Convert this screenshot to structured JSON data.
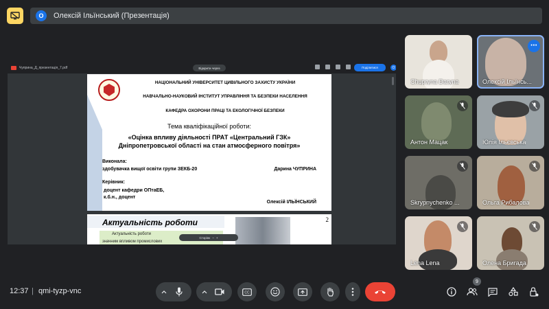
{
  "topbar": {
    "presenter_initial": "О",
    "presenter_title": "Олексій Ільїнський (Презентація)"
  },
  "pdf_viewer": {
    "file_name": "Чуприна_Д_презентація_7.pdf",
    "pill_label": "Відкрити через",
    "share_label": "Поділитися",
    "avatar_initial": "О",
    "zoom_label": "Сторінк"
  },
  "slide": {
    "line1": "НАЦІОНАЛЬНИЙ УНІВЕРСИТЕТ ЦИВІЛЬНОГО ЗАХИСТУ УКРАЇНИ",
    "line2": "НАВЧАЛЬНО-НАУКОВИЙ ІНСТИТУТ УПРАВЛІННЯ ТА БЕЗПЕКИ НАСЕЛЕННЯ",
    "line3": "КАФЕДРА ОХОРОНИ ПРАЦІ ТА ЕКОЛОГІЧНОЇ БЕЗПЕКИ",
    "topic_label": "Тема кваліфікаційної роботи:",
    "topic_line1": "«Оцінка впливу діяльності ПРАТ «Центральний ГЗК»",
    "topic_line2": "Дніпропетровської області на стан атмосферного повітря»",
    "performer_label": "Виконала:",
    "performer_desc": "здобувачка вищої освіти групи ЗЕКБ-20",
    "performer_name": "Дарина ЧУПРИНА",
    "supervisor_label": "Керівник:",
    "supervisor_desc1": "доцент кафедри ОПтаЕБ,",
    "supervisor_desc2": "к.б.н., доцент",
    "supervisor_name": "Олексій ІЛЬЇНСЬКИЙ"
  },
  "slide2": {
    "title": "Актуальність роботи",
    "page_number": "2",
    "text1": "Актуальність     роботи",
    "text2": "значним     впливом     промислових"
  },
  "participants": [
    {
      "name": "Chupryna Daryna",
      "muted": false
    },
    {
      "name": "Олексій Ільїнсь...",
      "muted": false,
      "active": true
    },
    {
      "name": "Антон Мацак",
      "muted": true
    },
    {
      "name": "Юлія Ільєвська",
      "muted": true
    },
    {
      "name": "Skrypnychenko ...",
      "muted": true
    },
    {
      "name": "Ольга Рибалова",
      "muted": true
    },
    {
      "name": "Lena Lena",
      "muted": true
    },
    {
      "name": "Олена Бригада",
      "muted": true
    }
  ],
  "bottombar": {
    "time": "12:37",
    "separator": "|",
    "meeting_code": "qmi-tyzp-vnc",
    "participant_count": "9"
  },
  "colors": {
    "background": "#202124",
    "control": "#3c4043",
    "accent_blue": "#1a73e8",
    "end_call": "#ea4335",
    "present_icon": "#fdd663"
  }
}
